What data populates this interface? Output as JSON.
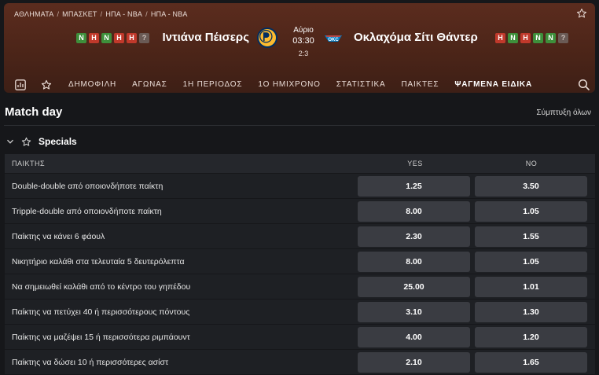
{
  "breadcrumb": [
    "ΑΘΛΗΜΑΤΑ",
    "ΜΠΑΣΚΕΤ",
    "ΗΠΑ - NBA",
    "ΗΠΑ - NBA"
  ],
  "match": {
    "home": {
      "name": "Ιντιάνα Πέισερς",
      "form": [
        "Ν",
        "Η",
        "Ν",
        "Η",
        "Η",
        "?"
      ]
    },
    "away": {
      "name": "Οκλαχόμα Σίτι Θάντερ",
      "form": [
        "Η",
        "Ν",
        "Η",
        "Ν",
        "Ν",
        "?"
      ]
    },
    "day": "Αύριο",
    "time": "03:30",
    "series": "2:3"
  },
  "tabs": [
    "ΔΗΜΟΦΙΛΗ",
    "ΑΓΩΝΑΣ",
    "1Η ΠΕΡΙΟΔΟΣ",
    "1Ο ΗΜΙΧΡΟΝΟ",
    "ΣΤΑΤΙΣΤΙΚΑ",
    "ΠΑΙΚΤΕΣ",
    "ΨΑΓΜΕΝΑ ΕΙΔΙΚΑ"
  ],
  "active_tab": 6,
  "section": {
    "title": "Match day",
    "collapse_all": "Σύμπτυξη όλων"
  },
  "market": {
    "name": "Specials",
    "columns": [
      "ΠΑΙΚΤΗΣ",
      "YES",
      "NO"
    ],
    "rows": [
      {
        "name": "Double-double από οποιονδήποτε παίκτη",
        "yes": "1.25",
        "no": "3.50"
      },
      {
        "name": "Tripple-double από οποιονδήποτε παίκτη",
        "yes": "8.00",
        "no": "1.05"
      },
      {
        "name": "Παίκτης να κάνει 6 φάουλ",
        "yes": "2.30",
        "no": "1.55"
      },
      {
        "name": "Νικητήριο καλάθι στα τελευταία 5 δευτερόλεπτα",
        "yes": "8.00",
        "no": "1.05"
      },
      {
        "name": "Να σημειωθεί καλάθι από το κέντρο του γηπέδου",
        "yes": "25.00",
        "no": "1.01"
      },
      {
        "name": "Παίκτης να πετύχει 40 ή περισσότερους πόντους",
        "yes": "3.10",
        "no": "1.30"
      },
      {
        "name": "Παίκτης να μαζέψει 15 ή περισσότερα ριμπάουντ",
        "yes": "4.00",
        "no": "1.20"
      },
      {
        "name": "Παίκτης να δώσει 10 ή περισσότερες ασίστ",
        "yes": "2.10",
        "no": "1.65"
      }
    ]
  },
  "colors": {
    "header_bg": "#5b2c1e",
    "win": "#3e8f3b",
    "loss": "#c0392b",
    "active_tab_underline": "#f5a623",
    "odds_button": "#3a3c42"
  },
  "icons": [
    "star-icon",
    "stats-icon",
    "search-icon",
    "chevron-down-icon",
    "pacers-logo",
    "thunder-logo"
  ]
}
